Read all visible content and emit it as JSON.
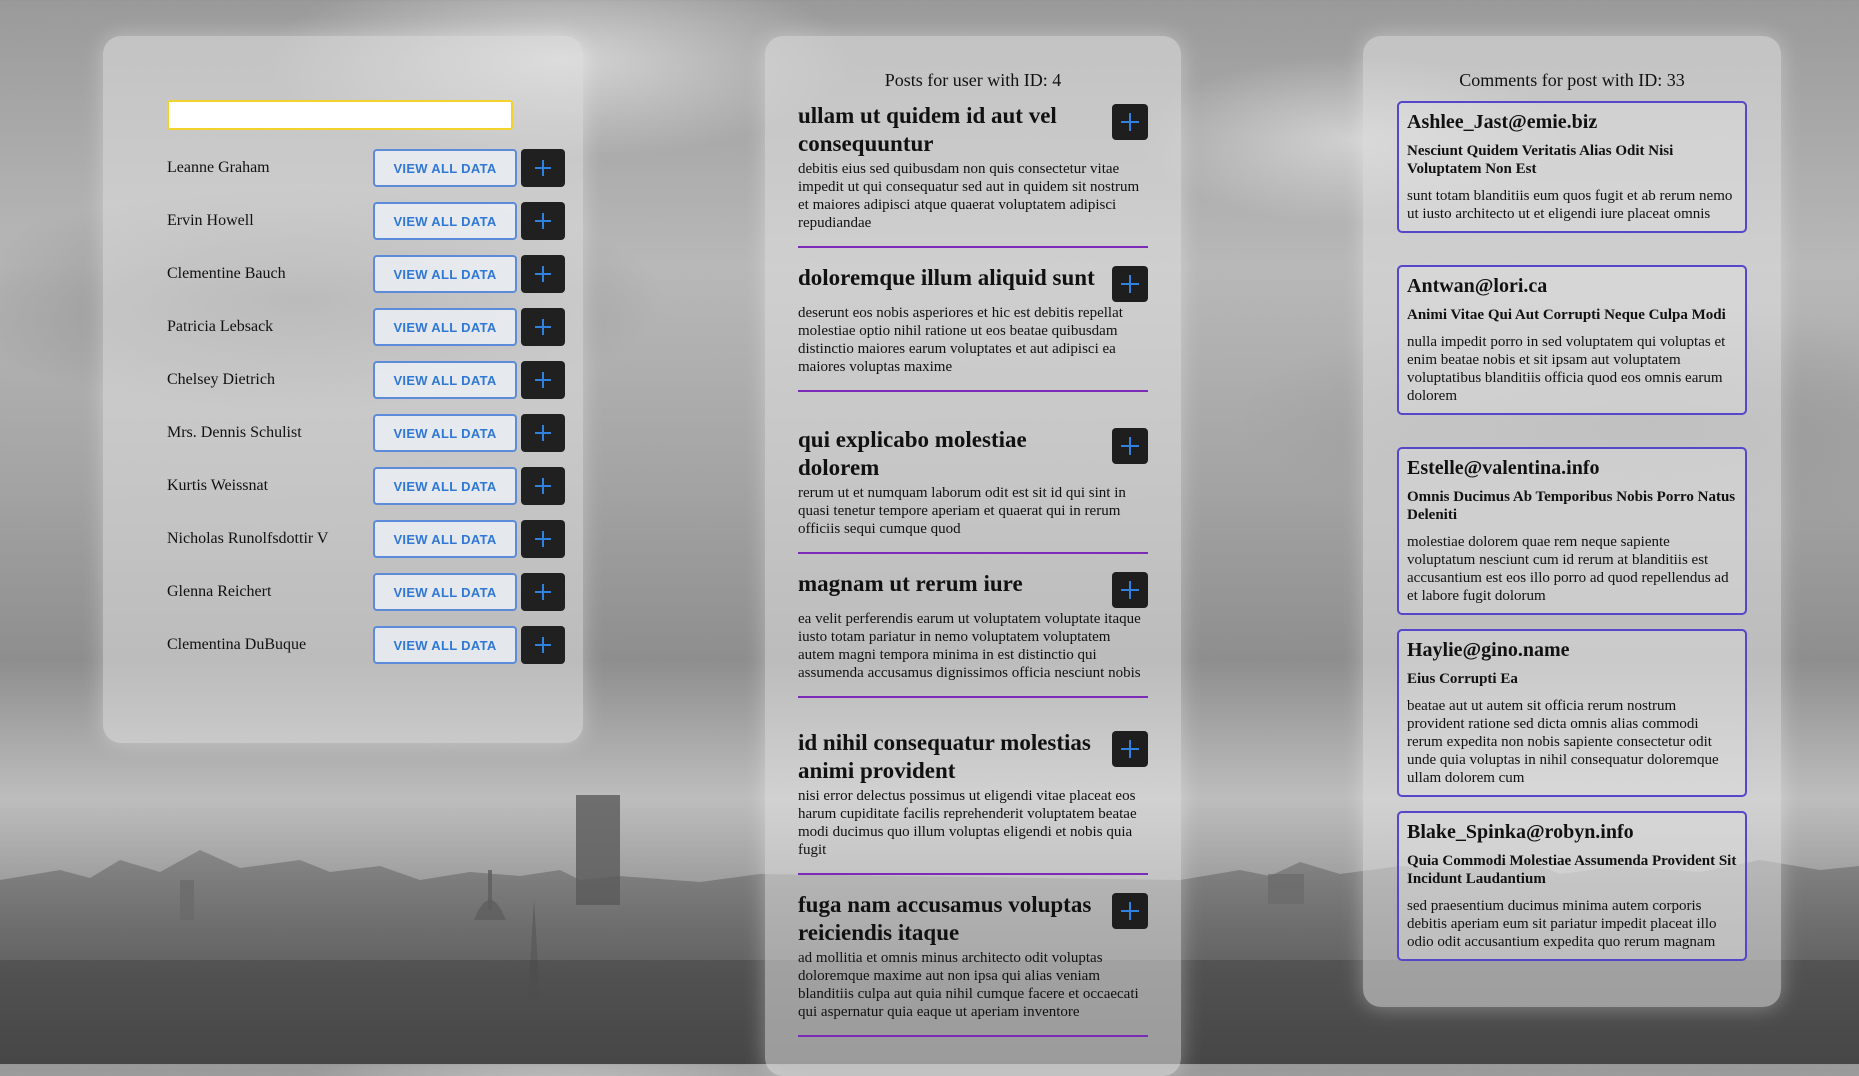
{
  "search": {
    "value": "",
    "placeholder": ""
  },
  "users": {
    "view_label": "VIEW ALL DATA",
    "items": [
      {
        "name": "Leanne Graham"
      },
      {
        "name": "Ervin Howell"
      },
      {
        "name": "Clementine Bauch"
      },
      {
        "name": "Patricia Lebsack"
      },
      {
        "name": "Chelsey Dietrich"
      },
      {
        "name": "Mrs. Dennis Schulist"
      },
      {
        "name": "Kurtis Weissnat"
      },
      {
        "name": "Nicholas Runolfsdottir V"
      },
      {
        "name": "Glenna Reichert"
      },
      {
        "name": "Clementina DuBuque"
      }
    ]
  },
  "posts": {
    "title": "Posts for user with ID: 4",
    "items": [
      {
        "title": "ullam ut quidem id aut vel consequuntur",
        "body": "debitis eius sed quibusdam non quis consectetur vitae impedit ut qui consequatur sed aut in quidem sit nostrum et maiores adipisci atque quaerat voluptatem adipisci repudiandae"
      },
      {
        "title": "doloremque illum aliquid sunt",
        "body": "deserunt eos nobis asperiores et hic est debitis repellat molestiae optio nihil ratione ut eos beatae quibusdam distinctio maiores earum voluptates et aut adipisci ea maiores voluptas maxime"
      },
      {
        "title": "qui explicabo molestiae dolorem",
        "body": "rerum ut et numquam laborum odit est sit id qui sint in quasi tenetur tempore aperiam et quaerat qui in rerum officiis sequi cumque quod"
      },
      {
        "title": "magnam ut rerum iure",
        "body": "ea velit perferendis earum ut voluptatem voluptate itaque iusto totam pariatur in nemo voluptatem voluptatem autem magni tempora minima in est distinctio qui assumenda accusamus dignissimos officia nesciunt nobis"
      },
      {
        "title": "id nihil consequatur molestias animi provident",
        "body": "nisi error delectus possimus ut eligendi vitae placeat eos harum cupiditate facilis reprehenderit voluptatem beatae modi ducimus quo illum voluptas eligendi et nobis quia fugit"
      },
      {
        "title": "fuga nam accusamus voluptas reiciendis itaque",
        "body": "ad mollitia et omnis minus architecto odit voluptas doloremque maxime aut non ipsa qui alias veniam blanditiis culpa aut quia nihil cumque facere et occaecati qui aspernatur quia eaque ut aperiam inventore"
      }
    ]
  },
  "comments": {
    "title": "Comments for post with ID: 33",
    "items": [
      {
        "email": "Ashlee_Jast@emie.biz",
        "name": "Nesciunt Quidem Veritatis Alias Odit Nisi Voluptatem Non Est",
        "body": "sunt totam blanditiis eum quos fugit et ab rerum nemo ut iusto architecto ut et eligendi iure placeat omnis"
      },
      {
        "email": "Antwan@lori.ca",
        "name": "Animi Vitae Qui Aut Corrupti Neque Culpa Modi",
        "body": "nulla impedit porro in sed voluptatem qui voluptas et enim beatae nobis et sit ipsam aut voluptatem voluptatibus blanditiis officia quod eos omnis earum dolorem"
      },
      {
        "email": "Estelle@valentina.info",
        "name": "Omnis Ducimus Ab Temporibus Nobis Porro Natus Deleniti",
        "body": "molestiae dolorem quae rem neque sapiente voluptatum nesciunt cum id rerum at blanditiis est accusantium est eos illo porro ad quod repellendus ad et labore fugit dolorum"
      },
      {
        "email": "Haylie@gino.name",
        "name": "Eius Corrupti Ea",
        "body": "beatae aut ut autem sit officia rerum nostrum provident ratione sed dicta omnis alias commodi rerum expedita non nobis sapiente consectetur odit unde quia voluptas in nihil consequatur doloremque ullam dolorem cum"
      },
      {
        "email": "Blake_Spinka@robyn.info",
        "name": "Quia Commodi Molestiae Assumenda Provident Sit Incidunt Laudantium",
        "body": "sed praesentium ducimus minima autem corporis debitis aperiam eum sit pariatur impedit placeat illo odio odit accusantium expedita quo rerum magnam"
      }
    ]
  },
  "colors": {
    "accent": "#2f78d6",
    "search_border": "#f2d32a",
    "post_divider": "#7b2bb5",
    "comment_border": "#5447c9"
  },
  "icons": {
    "add": "plus-icon"
  }
}
